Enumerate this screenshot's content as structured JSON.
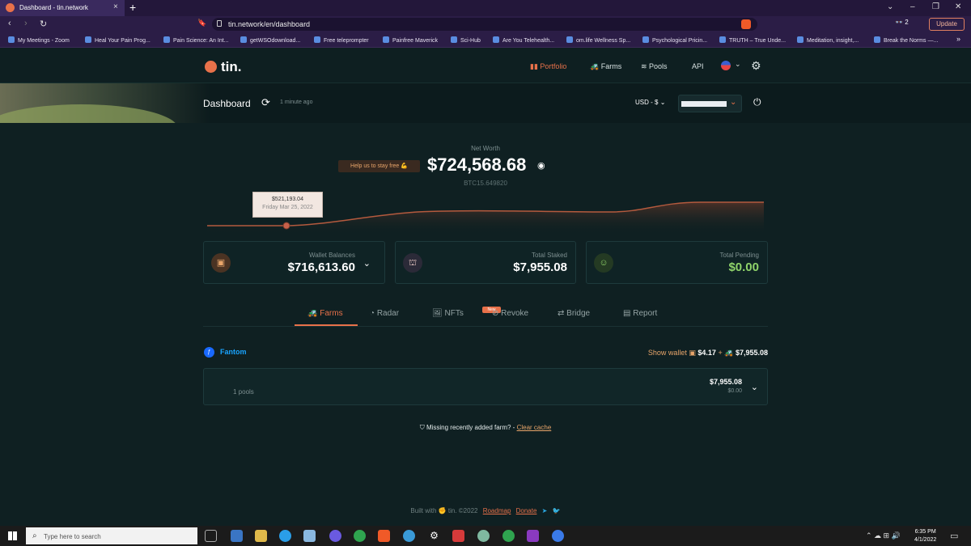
{
  "browser": {
    "tab_title": "Dashboard - tin.network",
    "tab_close": "×",
    "new_tab": "+",
    "url": "tin.network/en/dashboard",
    "nav_back": "‹",
    "nav_forward": "›",
    "nav_reload": "↻",
    "bookmark_icon": "🔖",
    "extensions_count": "2",
    "update_label": "Update",
    "window_controls": [
      "⌄",
      "–",
      "❐",
      "✕"
    ],
    "bookmarks": [
      "My Meetings - Zoom",
      "Heal Your Pain Prog...",
      "Pain Science: An Int...",
      "getWSOdownload...",
      "Free teleprompter",
      "Painfree Maverick",
      "Sci-Hub",
      "Are You Telehealth...",
      "om.life Wellness Sp...",
      "Psychological Pricin...",
      "TRUTH – True Unde...",
      "Meditation, insight,...",
      "Break the Norms —..."
    ],
    "bookmarks_more": "»"
  },
  "app": {
    "logo": "tin.",
    "nav": [
      {
        "label": "Portfolio",
        "icon": "chart-icon",
        "active": true
      },
      {
        "label": "Farms",
        "icon": "tractor-icon",
        "active": false
      },
      {
        "label": "Pools",
        "icon": "pool-icon",
        "active": false
      },
      {
        "label": "API",
        "icon": "",
        "active": false
      }
    ],
    "accent": "#e8714a",
    "page_title": "Dashboard",
    "updated": "1 minute ago",
    "currency": "USD - $",
    "net_worth_label": "Net Worth",
    "help_us": "Help us to stay free 💪",
    "net_worth": "$724,568.68",
    "btc_value": "BTC15.649820",
    "tooltip_value": "$521,193.04",
    "tooltip_date": "Friday Mar 25, 2022",
    "cards": [
      {
        "label": "Wallet Balances",
        "value": "$716,613.60",
        "icon": "wallet-icon"
      },
      {
        "label": "Total Staked",
        "value": "$7,955.08",
        "icon": "stake-icon"
      },
      {
        "label": "Total Pending",
        "value": "$0.00",
        "icon": "smiley-icon"
      }
    ],
    "tabs": [
      {
        "label": "Farms",
        "icon": "🚜"
      },
      {
        "label": "Radar",
        "icon": "◔"
      },
      {
        "label": "NFTs",
        "icon": "🖼"
      },
      {
        "label": "Revoke",
        "icon": "⊘"
      },
      {
        "label": "Bridge",
        "icon": "⇄"
      },
      {
        "label": "Report",
        "icon": "▤"
      }
    ],
    "new_badge": "New",
    "chain": "Fantom",
    "show_wallet": "Show wallet",
    "wallet_amount": "$4.17",
    "plus": "+",
    "farm_amount": "$7,955.08",
    "pools_count": "1 pools",
    "pool_value": "$7,955.08",
    "pool_pending": "$0.00",
    "missing_text": "Missing recently added farm? -",
    "clear_cache": "Clear cache",
    "footer_built": "Built with",
    "footer_brand": "tin. ©2022",
    "roadmap": "Roadmap",
    "donate": "Donate"
  },
  "taskbar": {
    "search_placeholder": "Type here to search",
    "time": "6:35 PM",
    "date": "4/1/2022"
  }
}
